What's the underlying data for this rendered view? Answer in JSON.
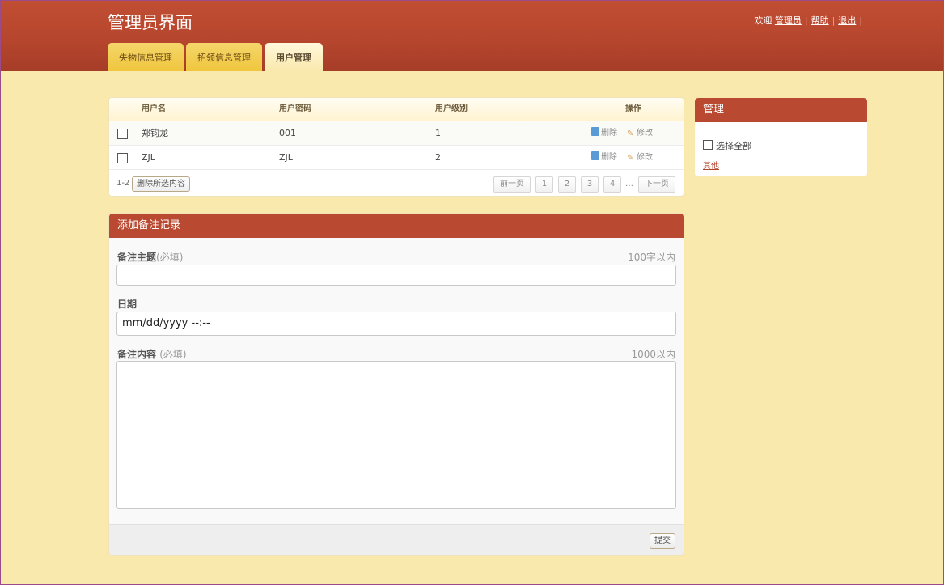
{
  "header": {
    "title": "管理员界面",
    "welcome": "欢迎",
    "admin_link": "管理员",
    "help_link": "帮助",
    "logout_link": "退出",
    "separator": "|"
  },
  "tabs": [
    {
      "label": "失物信息管理",
      "active": false
    },
    {
      "label": "招领信息管理",
      "active": false
    },
    {
      "label": "用户管理",
      "active": true
    }
  ],
  "user_table": {
    "columns": [
      "用户名",
      "用户密码",
      "用户级别",
      "操作"
    ],
    "rows": [
      {
        "name": "郑钧龙",
        "password": "001",
        "level": "1"
      },
      {
        "name": "ZJL",
        "password": "ZJL",
        "level": "2"
      }
    ],
    "delete_label": "删除",
    "edit_label": "修改",
    "range": "1-2",
    "delete_selected": "删除所选内容",
    "pager": {
      "prev": "前一页",
      "pages": [
        "1",
        "2",
        "3",
        "4"
      ],
      "ellipsis": "…",
      "next": "下一页"
    }
  },
  "form": {
    "title": "添加备注记录",
    "subject_label": "备注主题",
    "subject_hint": "(必填)",
    "subject_limit": "100字以内",
    "date_label": "日期",
    "date_value": "mm/dd/yyyy --:--",
    "content_label": "备注内容",
    "content_hint": "(必填)",
    "content_limit": "1000以内",
    "submit": "提交"
  },
  "side": {
    "title": "管理",
    "select_all": "选择全部",
    "other": "其他"
  },
  "colors": {
    "header": "#b5452d",
    "background": "#f9e9ad",
    "tab": "#f0c63e",
    "panel_head": "#b94a31"
  }
}
